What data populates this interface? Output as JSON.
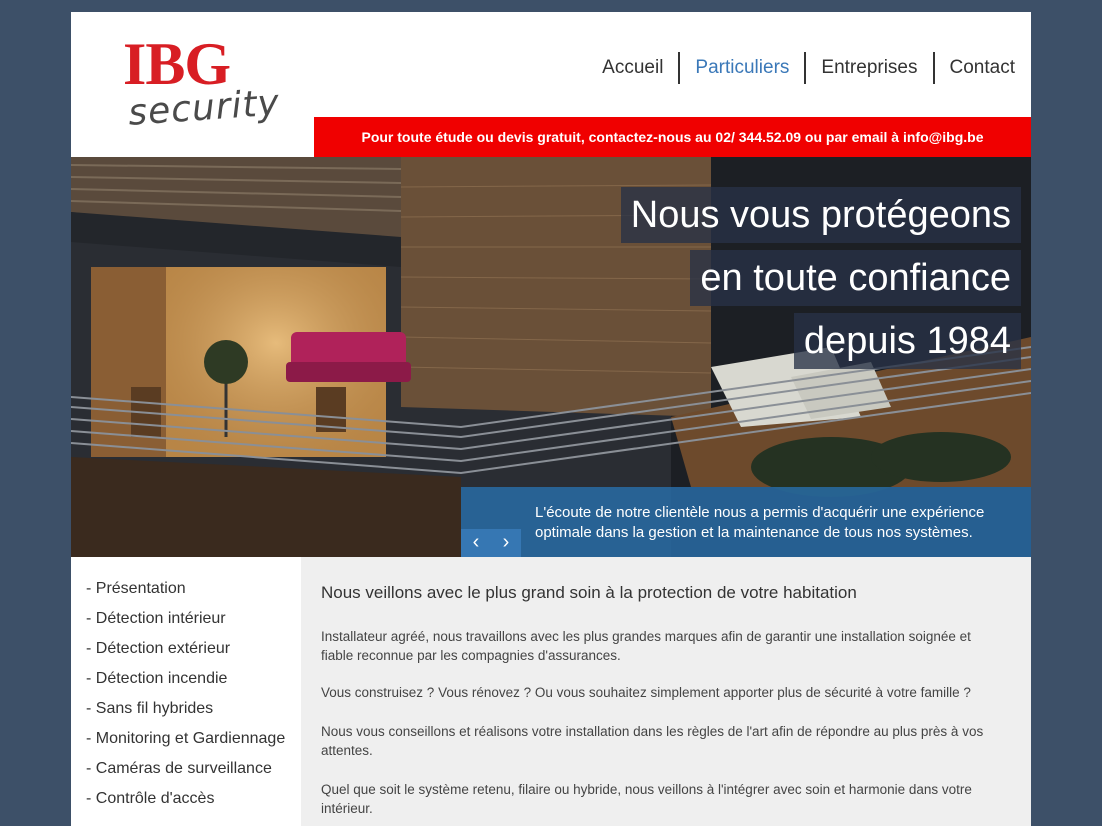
{
  "logo": {
    "brand": "IBG",
    "tagline": "security"
  },
  "nav": {
    "items": [
      {
        "label": "Accueil",
        "active": false
      },
      {
        "label": "Particuliers",
        "active": true
      },
      {
        "label": "Entreprises",
        "active": false
      },
      {
        "label": "Contact",
        "active": false
      }
    ]
  },
  "contact_bar": "Pour toute étude ou devis gratuit, contactez-nous au 02/ 344.52.09 ou par email à info@ibg.be",
  "hero": {
    "headline": [
      "Nous vous protégeons",
      "en toute confiance",
      "depuis 1984"
    ],
    "caption": "L'écoute de notre clientèle nous a permis d'acquérir une expérience optimale dans la gestion et la maintenance de tous nos systèmes.",
    "prev_icon": "chevron-left-icon",
    "next_icon": "chevron-right-icon"
  },
  "sidebar": {
    "items": [
      "- Présentation",
      "- Détection intérieur",
      "- Détection extérieur",
      "- Détection incendie",
      "- Sans fil hybrides",
      "- Monitoring et Gardiennage",
      "- Caméras de surveillance",
      "- Contrôle d'accès"
    ]
  },
  "main": {
    "title": "Nous veillons avec le plus grand soin à la protection de votre habitation",
    "paragraphs": [
      "Installateur agréé, nous travaillons avec les plus grandes marques afin de garantir une installation soignée et fiable reconnue par les compagnies d'assurances.",
      "Vous construisez ? Vous rénovez ? Ou vous souhaitez simplement apporter plus de sécurité à votre famille ?",
      "Nous vous conseillons et réalisons votre installation dans les règles de l'art afin de répondre au plus près à vos attentes.",
      "Quel que soit le système retenu, filaire ou hybride, nous veillons à l'intégrer avec soin et harmonie dans votre intérieur."
    ]
  },
  "colors": {
    "background": "#3d5068",
    "brand_red": "#d81e24",
    "contact_bar": "#f00000",
    "nav_active": "#3a78b8",
    "caption_blue": "#286eaa"
  }
}
